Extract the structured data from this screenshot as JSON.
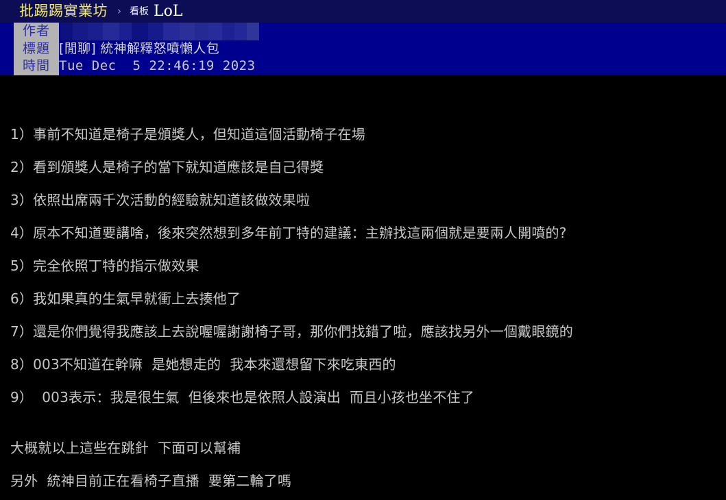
{
  "breadcrumb": {
    "site": "批踢踢實業坊",
    "separator": "›",
    "board_label": "看板",
    "board_name": "LoL"
  },
  "article_meta": {
    "labels": {
      "author": "作者",
      "title": "標題",
      "time": "時間"
    },
    "author_value": "",
    "title_value": "[閒聊] 統神解釋怒噴懶人包",
    "time_value": "Tue Dec  5 22:46:19 2023"
  },
  "post": {
    "lines": [
      "1）事前不知道是椅子是頒獎人，但知道這個活動椅子在場",
      "2）看到頒獎人是椅子的當下就知道應該是自己得獎",
      "3）依照出席兩千次活動的經驗就知道該做效果啦",
      "4）原本不知道要講啥，後來突然想到多年前丁特的建議：主辦找這兩個就是要兩人開噴的?",
      "5）完全依照丁特的指示做效果",
      "6）我如果真的生氣早就衝上去揍他了",
      "7）還是你們覺得我應該上去說喔喔謝謝椅子哥，那你們找錯了啦，應該找另外一個戴眼鏡的",
      "8）003不知道在幹嘛  是她想走的  我本來還想留下來吃東西的",
      "9）  003表示：我是很生氣  但後來也是依照人設演出  而且小孩也坐不住了"
    ],
    "closing": [
      "大概就以上這些在跳針  下面可以幫補",
      "另外  統神目前正在看椅子直播  要第二輪了嗎"
    ]
  },
  "colors": {
    "breadcrumb_bg": "#0d0d56",
    "site_text": "#f2e85c",
    "meta_bg": "#00008e",
    "meta_label_bg": "#b3b3b3",
    "meta_label_text": "#2a2ab0",
    "body_bg": "#000000",
    "body_text": "#c8c8c8"
  }
}
